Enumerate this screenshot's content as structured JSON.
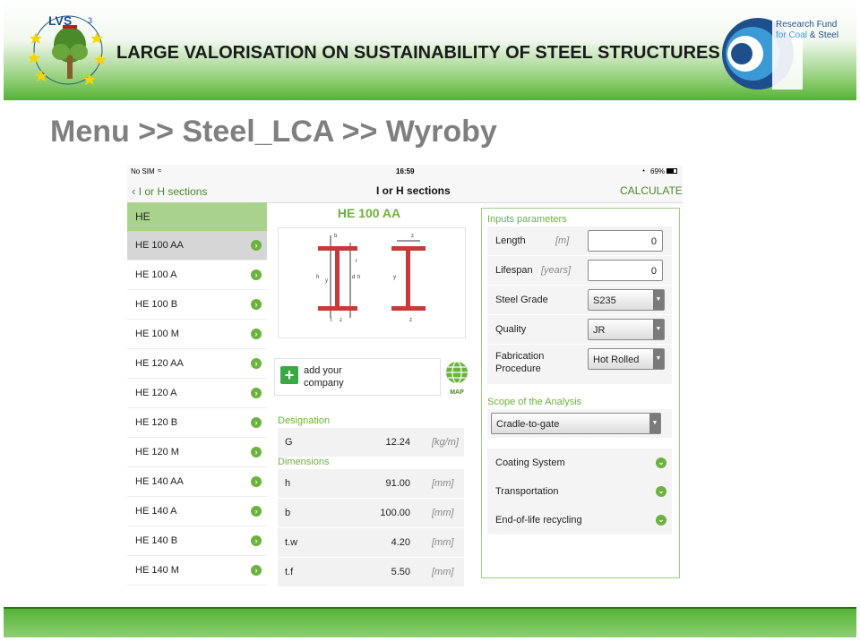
{
  "banner": {
    "title": "LARGE VALORISATION ON SUSTAINABILITY OF STEEL STRUCTURES",
    "logo_left_text": "LVS",
    "logo_left_superscript": "3",
    "logo_right_line1": "Research Fund",
    "logo_right_line2_a": "for Coal",
    "logo_right_line2_b": "& Steel"
  },
  "page_title": "Menu >> Steel_LCA >> Wyroby",
  "status_bar": {
    "carrier": "No SIM",
    "time": "16:59",
    "battery": "69%"
  },
  "nav": {
    "back_label": "I or H sections",
    "title": "I or H sections",
    "action_label": "CALCULATE"
  },
  "section_list": {
    "header": "HE",
    "items": [
      {
        "label": "HE 100 AA",
        "selected": true
      },
      {
        "label": "HE 100 A"
      },
      {
        "label": "HE 100 B"
      },
      {
        "label": "HE 100 M"
      },
      {
        "label": "HE 120 AA"
      },
      {
        "label": "HE 120 A"
      },
      {
        "label": "HE 120 B"
      },
      {
        "label": "HE 120 M"
      },
      {
        "label": "HE 140 AA"
      },
      {
        "label": "HE 140 A"
      },
      {
        "label": "HE 140 B"
      },
      {
        "label": "HE 140 M"
      }
    ]
  },
  "detail": {
    "section_name": "HE 100 AA",
    "add_company_line1": "add your",
    "add_company_line2": "company",
    "map_label": "MAP",
    "designation_label": "Designation",
    "designation": {
      "symbol": "G",
      "value": "12.24",
      "unit": "[kg/m]"
    },
    "dimensions_label": "Dimensions",
    "dimensions": [
      {
        "symbol": "h",
        "value": "91.00",
        "unit": "[mm]"
      },
      {
        "symbol": "b",
        "value": "100.00",
        "unit": "[mm]"
      },
      {
        "symbol": "t.w",
        "value": "4.20",
        "unit": "[mm]"
      },
      {
        "symbol": "t.f",
        "value": "5.50",
        "unit": "[mm]"
      }
    ]
  },
  "inputs": {
    "title": "Inputs parameters",
    "length": {
      "label": "Length",
      "unit": "[m]",
      "value": "0"
    },
    "lifespan": {
      "label": "Lifespan",
      "unit": "[years]",
      "value": "0"
    },
    "steel_grade": {
      "label": "Steel Grade",
      "value": "S235"
    },
    "quality": {
      "label": "Quality",
      "value": "JR"
    },
    "fabrication": {
      "label_line1": "Fabrication",
      "label_line2": "Procedure",
      "value": "Hot Rolled"
    },
    "scope_title": "Scope of the Analysis",
    "scope_value": "Cradle-to-gate",
    "accordion": [
      {
        "label": "Coating System"
      },
      {
        "label": "Transportation"
      },
      {
        "label": "End-of-life recycling"
      }
    ]
  },
  "colors": {
    "accent_green": "#6cb23e",
    "banner_green": "#54b335",
    "title_gray": "#7f7f7f"
  }
}
